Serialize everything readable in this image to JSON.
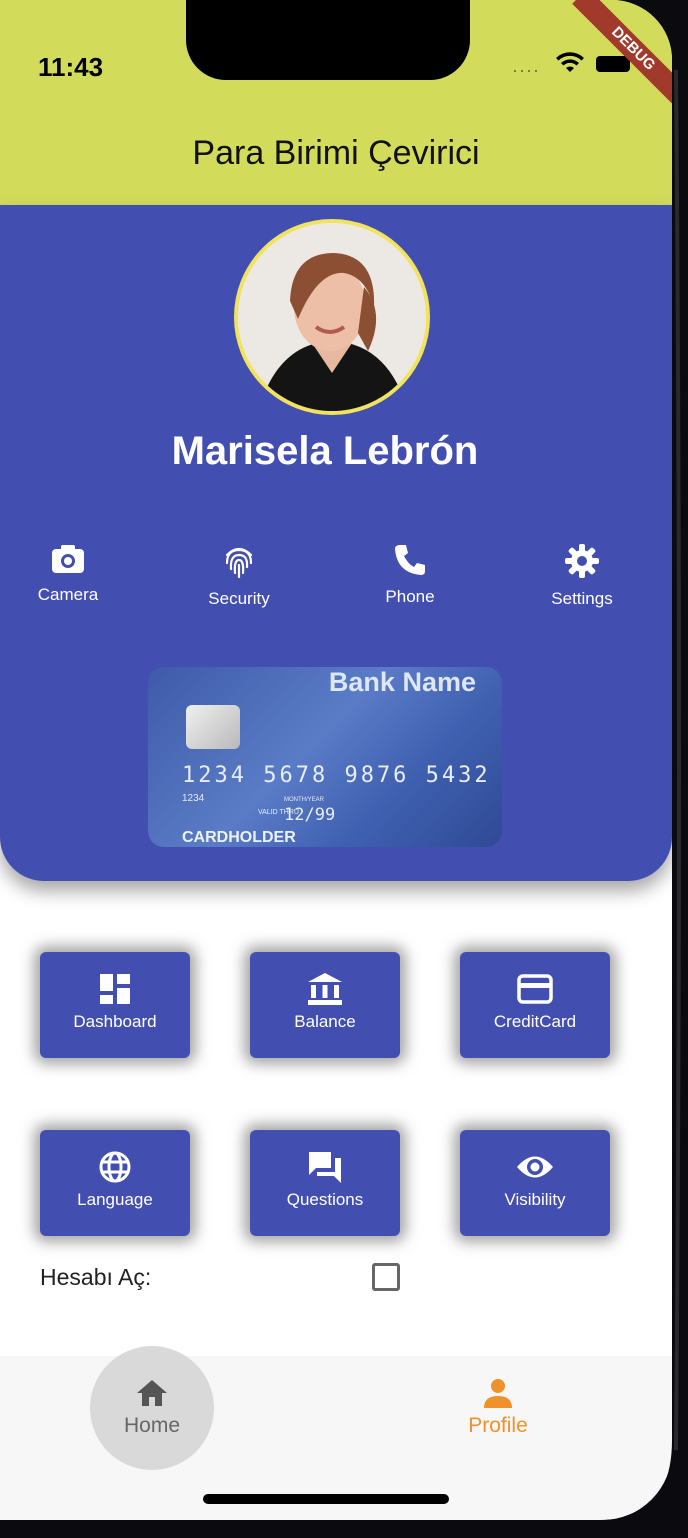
{
  "status_bar": {
    "time": "11:43",
    "debug_banner": "DEBUG"
  },
  "app_bar": {
    "title": "Para Birimi Çevirici",
    "background": "#d2db5a"
  },
  "profile": {
    "name": "Marisela Lebrón",
    "panel_color": "#434fb0",
    "avatar_border": "#f1e45c"
  },
  "actions": [
    {
      "label": "Camera",
      "icon": "camera-icon"
    },
    {
      "label": "Security",
      "icon": "fingerprint-icon"
    },
    {
      "label": "Phone",
      "icon": "phone-icon"
    },
    {
      "label": "Settings",
      "icon": "gear-icon"
    }
  ],
  "card": {
    "bank_name": "Bank Name",
    "number": "1234 5678 9876 5432",
    "small_number": "1234",
    "valid_thru_label": "VALID THRU",
    "month_year_label": "MONTH/YEAR",
    "expiry": "12/99",
    "holder": "CARDHOLDER"
  },
  "grid": [
    {
      "label": "Dashboard",
      "icon": "dashboard-icon"
    },
    {
      "label": "Balance",
      "icon": "bank-icon"
    },
    {
      "label": "CreditCard",
      "icon": "credit-card-icon"
    },
    {
      "label": "Language",
      "icon": "globe-icon"
    },
    {
      "label": "Questions",
      "icon": "chat-icon"
    },
    {
      "label": "Visibility",
      "icon": "eye-icon"
    }
  ],
  "account_toggle": {
    "label": "Hesabı Aç:",
    "checked": false
  },
  "bottom_nav": {
    "items": [
      {
        "label": "Home",
        "icon": "home-icon",
        "selected": false
      },
      {
        "label": "Profile",
        "icon": "person-icon",
        "selected": true
      }
    ],
    "active_color": "#f0922b"
  }
}
